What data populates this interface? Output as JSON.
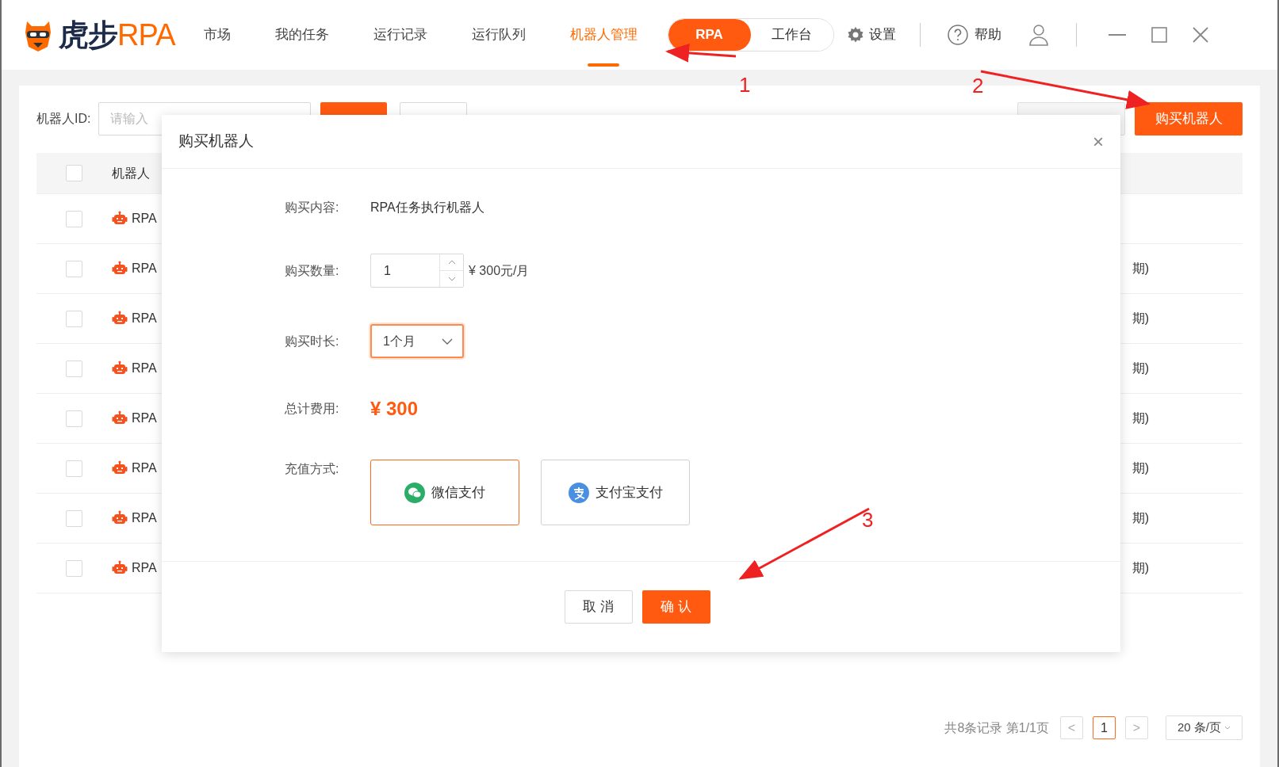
{
  "logo": {
    "primary": "虎步",
    "accent": "RPA"
  },
  "nav": [
    {
      "label": "市场",
      "selected": false
    },
    {
      "label": "我的任务",
      "selected": false
    },
    {
      "label": "运行记录",
      "selected": false
    },
    {
      "label": "运行队列",
      "selected": false
    },
    {
      "label": "机器人管理",
      "selected": true
    }
  ],
  "mode_toggle": [
    {
      "label": "RPA",
      "selected": true
    },
    {
      "label": "工作台",
      "selected": false
    }
  ],
  "header_actions": {
    "settings": "设置",
    "help": "帮助"
  },
  "toolbar": {
    "id_label": "机器人ID:",
    "id_placeholder": "请输入",
    "buy_button": "购买机器人"
  },
  "table": {
    "all_checked": false,
    "columns": [
      "机器人"
    ],
    "rows": [
      {
        "name": "RPA",
        "checked": false
      },
      {
        "name": "RPA",
        "checked": false,
        "status": "期)"
      },
      {
        "name": "RPA",
        "checked": false,
        "status": "期)"
      },
      {
        "name": "RPA",
        "checked": false,
        "status": "期)"
      },
      {
        "name": "RPA",
        "checked": false,
        "status": "期)"
      },
      {
        "name": "RPA",
        "checked": false,
        "status": "期)"
      },
      {
        "name": "RPA",
        "checked": false,
        "status": "期)"
      },
      {
        "name": "RPA",
        "checked": false,
        "status": "期)"
      }
    ]
  },
  "pagination": {
    "summary": "共8条记录 第1/1页",
    "prev": "<",
    "pages": [
      {
        "label": "1",
        "selected": true
      }
    ],
    "next": ">",
    "page_size": "20 条/页"
  },
  "dialog": {
    "title": "购买机器人",
    "close": "×",
    "fields": [
      {
        "kind": "text",
        "label": "购买内容:",
        "value": "RPA任务执行机器人"
      },
      {
        "kind": "number",
        "label": "购买数量:",
        "value": "1",
        "unit": "¥ 300元/月"
      },
      {
        "kind": "select",
        "label": "购买时长:",
        "value": "1个月"
      },
      {
        "kind": "price",
        "label": "总计费用:",
        "value": "¥ 300"
      },
      {
        "kind": "payment",
        "label": "充值方式:",
        "options": [
          {
            "label": "微信支付",
            "kind": "wechat",
            "selected": true
          },
          {
            "label": "支付宝支付",
            "kind": "alipay",
            "selected": false
          }
        ]
      }
    ],
    "cancel": "取 消",
    "confirm": "确 认"
  },
  "annotations": [
    {
      "number": "1"
    },
    {
      "number": "2"
    },
    {
      "number": "3"
    }
  ]
}
